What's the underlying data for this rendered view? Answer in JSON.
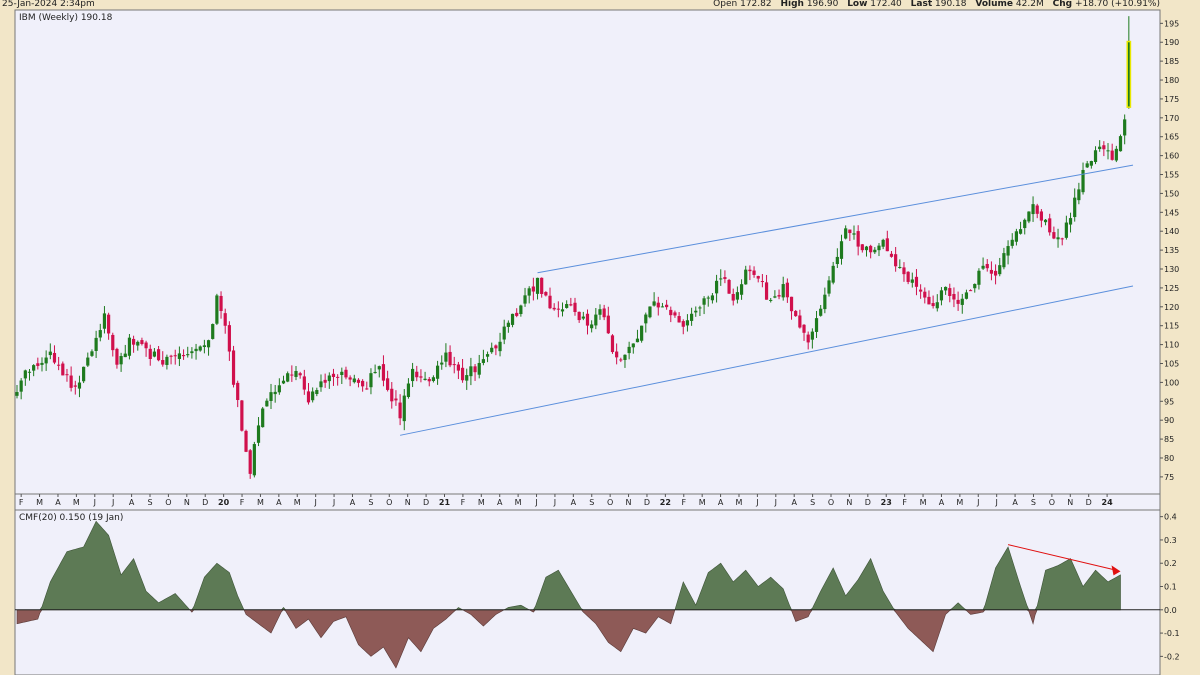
{
  "header": {
    "timestamp": "25-Jan-2024 2:34pm",
    "open_label": "Open",
    "open": "172.82",
    "high_label": "High",
    "high": "196.90",
    "low_label": "Low",
    "low": "172.40",
    "last_label": "Last",
    "last": "190.18",
    "volume_label": "Volume",
    "volume": "42.2M",
    "chg_label": "Chg",
    "chg": "+18.70 (+10.91%)"
  },
  "chart_data": [
    {
      "type": "candlestick",
      "legend": "IBM (Weekly) 190.18",
      "ylim": [
        71,
        198
      ],
      "yticks": [
        75,
        80,
        85,
        90,
        95,
        100,
        105,
        110,
        115,
        120,
        125,
        130,
        135,
        140,
        145,
        150,
        155,
        160,
        165,
        170,
        175,
        180,
        185,
        190,
        195
      ],
      "x_months": [
        "F",
        "M",
        "A",
        "M",
        "J",
        "J",
        "A",
        "S",
        "O",
        "N",
        "D",
        "20",
        "F",
        "M",
        "A",
        "M",
        "J",
        "J",
        "A",
        "S",
        "O",
        "N",
        "D",
        "21",
        "F",
        "M",
        "A",
        "M",
        "J",
        "J",
        "A",
        "S",
        "O",
        "N",
        "D",
        "22",
        "F",
        "M",
        "A",
        "M",
        "J",
        "J",
        "A",
        "S",
        "O",
        "N",
        "D",
        "23",
        "F",
        "M",
        "A",
        "M",
        "J",
        "J",
        "A",
        "S",
        "O",
        "N",
        "D",
        "24"
      ],
      "colors": {
        "up": "#1e7a1e",
        "down": "#d0104c",
        "highlight": "#e8e800",
        "trend": "#5b8fdc"
      },
      "series_close": [
        {
          "t": 0,
          "v": 97
        },
        {
          "t": 2,
          "v": 103
        },
        {
          "t": 5,
          "v": 105
        },
        {
          "t": 8,
          "v": 108
        },
        {
          "t": 11,
          "v": 103
        },
        {
          "t": 14,
          "v": 98
        },
        {
          "t": 18,
          "v": 108
        },
        {
          "t": 21,
          "v": 117
        },
        {
          "t": 24,
          "v": 104
        },
        {
          "t": 27,
          "v": 111
        },
        {
          "t": 30,
          "v": 109
        },
        {
          "t": 34,
          "v": 106
        },
        {
          "t": 38,
          "v": 106
        },
        {
          "t": 42,
          "v": 107
        },
        {
          "t": 46,
          "v": 110
        },
        {
          "t": 48,
          "v": 122
        },
        {
          "t": 50,
          "v": 114
        },
        {
          "t": 52,
          "v": 100
        },
        {
          "t": 54,
          "v": 88
        },
        {
          "t": 56,
          "v": 76
        },
        {
          "t": 58,
          "v": 90
        },
        {
          "t": 61,
          "v": 98
        },
        {
          "t": 64,
          "v": 100
        },
        {
          "t": 67,
          "v": 104
        },
        {
          "t": 70,
          "v": 95
        },
        {
          "t": 73,
          "v": 101
        },
        {
          "t": 76,
          "v": 100
        },
        {
          "t": 79,
          "v": 102
        },
        {
          "t": 83,
          "v": 98
        },
        {
          "t": 87,
          "v": 104
        },
        {
          "t": 90,
          "v": 96
        },
        {
          "t": 92,
          "v": 92
        },
        {
          "t": 95,
          "v": 103
        },
        {
          "t": 99,
          "v": 100
        },
        {
          "t": 103,
          "v": 107
        },
        {
          "t": 107,
          "v": 102
        },
        {
          "t": 111,
          "v": 104
        },
        {
          "t": 115,
          "v": 110
        },
        {
          "t": 119,
          "v": 117
        },
        {
          "t": 122,
          "v": 122
        },
        {
          "t": 125,
          "v": 127
        },
        {
          "t": 129,
          "v": 118
        },
        {
          "t": 133,
          "v": 120
        },
        {
          "t": 137,
          "v": 115
        },
        {
          "t": 140,
          "v": 120
        },
        {
          "t": 143,
          "v": 108
        },
        {
          "t": 146,
          "v": 106
        },
        {
          "t": 150,
          "v": 115
        },
        {
          "t": 153,
          "v": 121
        },
        {
          "t": 156,
          "v": 120
        },
        {
          "t": 159,
          "v": 115
        },
        {
          "t": 162,
          "v": 117
        },
        {
          "t": 165,
          "v": 121
        },
        {
          "t": 169,
          "v": 128
        },
        {
          "t": 172,
          "v": 122
        },
        {
          "t": 175,
          "v": 130
        },
        {
          "t": 178,
          "v": 128
        },
        {
          "t": 181,
          "v": 121
        },
        {
          "t": 184,
          "v": 125
        },
        {
          "t": 187,
          "v": 118
        },
        {
          "t": 190,
          "v": 112
        },
        {
          "t": 193,
          "v": 118
        },
        {
          "t": 196,
          "v": 130
        },
        {
          "t": 199,
          "v": 140
        },
        {
          "t": 202,
          "v": 137
        },
        {
          "t": 205,
          "v": 134
        },
        {
          "t": 208,
          "v": 138
        },
        {
          "t": 211,
          "v": 131
        },
        {
          "t": 214,
          "v": 128
        },
        {
          "t": 217,
          "v": 124
        },
        {
          "t": 220,
          "v": 121
        },
        {
          "t": 223,
          "v": 124
        },
        {
          "t": 226,
          "v": 120
        },
        {
          "t": 229,
          "v": 125
        },
        {
          "t": 232,
          "v": 130
        },
        {
          "t": 235,
          "v": 128
        },
        {
          "t": 238,
          "v": 137
        },
        {
          "t": 241,
          "v": 140
        },
        {
          "t": 244,
          "v": 146
        },
        {
          "t": 247,
          "v": 142
        },
        {
          "t": 250,
          "v": 137
        },
        {
          "t": 253,
          "v": 144
        },
        {
          "t": 256,
          "v": 155
        },
        {
          "t": 259,
          "v": 160
        },
        {
          "t": 261,
          "v": 162
        },
        {
          "t": 263,
          "v": 158
        },
        {
          "t": 265,
          "v": 166
        },
        {
          "t": 266,
          "v": 171
        },
        {
          "t": 267,
          "v": 190
        }
      ]
    },
    {
      "type": "area",
      "legend": "CMF(20) 0.150 (19 Jan)",
      "ylim": [
        -0.28,
        0.42
      ],
      "yticks": [
        -0.2,
        -0.1,
        0.0,
        0.1,
        0.2,
        0.3,
        0.4
      ],
      "colors": {
        "positive": "#5d7a55",
        "negative": "#8e5a57",
        "arrow": "#e01010"
      },
      "values": [
        {
          "t": 0,
          "v": -0.06
        },
        {
          "t": 5,
          "v": -0.04
        },
        {
          "t": 8,
          "v": 0.12
        },
        {
          "t": 12,
          "v": 0.25
        },
        {
          "t": 16,
          "v": 0.27
        },
        {
          "t": 19,
          "v": 0.38
        },
        {
          "t": 22,
          "v": 0.32
        },
        {
          "t": 25,
          "v": 0.15
        },
        {
          "t": 28,
          "v": 0.22
        },
        {
          "t": 31,
          "v": 0.08
        },
        {
          "t": 34,
          "v": 0.03
        },
        {
          "t": 38,
          "v": 0.07
        },
        {
          "t": 42,
          "v": -0.01
        },
        {
          "t": 45,
          "v": 0.14
        },
        {
          "t": 48,
          "v": 0.2
        },
        {
          "t": 51,
          "v": 0.16
        },
        {
          "t": 53,
          "v": 0.06
        },
        {
          "t": 55,
          "v": -0.02
        },
        {
          "t": 58,
          "v": -0.06
        },
        {
          "t": 61,
          "v": -0.1
        },
        {
          "t": 64,
          "v": 0.01
        },
        {
          "t": 67,
          "v": -0.08
        },
        {
          "t": 70,
          "v": -0.04
        },
        {
          "t": 73,
          "v": -0.12
        },
        {
          "t": 76,
          "v": -0.05
        },
        {
          "t": 79,
          "v": -0.03
        },
        {
          "t": 82,
          "v": -0.15
        },
        {
          "t": 85,
          "v": -0.2
        },
        {
          "t": 88,
          "v": -0.16
        },
        {
          "t": 91,
          "v": -0.25
        },
        {
          "t": 94,
          "v": -0.12
        },
        {
          "t": 97,
          "v": -0.18
        },
        {
          "t": 100,
          "v": -0.08
        },
        {
          "t": 103,
          "v": -0.04
        },
        {
          "t": 106,
          "v": 0.01
        },
        {
          "t": 109,
          "v": -0.02
        },
        {
          "t": 112,
          "v": -0.07
        },
        {
          "t": 115,
          "v": -0.02
        },
        {
          "t": 118,
          "v": 0.01
        },
        {
          "t": 121,
          "v": 0.02
        },
        {
          "t": 124,
          "v": -0.01
        },
        {
          "t": 127,
          "v": 0.14
        },
        {
          "t": 130,
          "v": 0.17
        },
        {
          "t": 133,
          "v": 0.08
        },
        {
          "t": 136,
          "v": -0.01
        },
        {
          "t": 139,
          "v": -0.06
        },
        {
          "t": 142,
          "v": -0.14
        },
        {
          "t": 145,
          "v": -0.18
        },
        {
          "t": 148,
          "v": -0.08
        },
        {
          "t": 151,
          "v": -0.1
        },
        {
          "t": 154,
          "v": -0.03
        },
        {
          "t": 157,
          "v": -0.06
        },
        {
          "t": 160,
          "v": 0.12
        },
        {
          "t": 163,
          "v": 0.02
        },
        {
          "t": 166,
          "v": 0.16
        },
        {
          "t": 169,
          "v": 0.2
        },
        {
          "t": 172,
          "v": 0.12
        },
        {
          "t": 175,
          "v": 0.17
        },
        {
          "t": 178,
          "v": 0.1
        },
        {
          "t": 181,
          "v": 0.14
        },
        {
          "t": 184,
          "v": 0.09
        },
        {
          "t": 187,
          "v": -0.05
        },
        {
          "t": 190,
          "v": -0.03
        },
        {
          "t": 193,
          "v": 0.08
        },
        {
          "t": 196,
          "v": 0.18
        },
        {
          "t": 199,
          "v": 0.06
        },
        {
          "t": 202,
          "v": 0.13
        },
        {
          "t": 205,
          "v": 0.22
        },
        {
          "t": 208,
          "v": 0.08
        },
        {
          "t": 211,
          "v": -0.01
        },
        {
          "t": 214,
          "v": -0.08
        },
        {
          "t": 217,
          "v": -0.13
        },
        {
          "t": 220,
          "v": -0.18
        },
        {
          "t": 223,
          "v": -0.02
        },
        {
          "t": 226,
          "v": 0.03
        },
        {
          "t": 229,
          "v": -0.02
        },
        {
          "t": 232,
          "v": -0.01
        },
        {
          "t": 235,
          "v": 0.18
        },
        {
          "t": 238,
          "v": 0.27
        },
        {
          "t": 241,
          "v": 0.1
        },
        {
          "t": 244,
          "v": -0.06
        },
        {
          "t": 247,
          "v": 0.17
        },
        {
          "t": 250,
          "v": 0.19
        },
        {
          "t": 253,
          "v": 0.22
        },
        {
          "t": 256,
          "v": 0.1
        },
        {
          "t": 259,
          "v": 0.17
        },
        {
          "t": 262,
          "v": 0.12
        },
        {
          "t": 265,
          "v": 0.15
        }
      ]
    }
  ]
}
